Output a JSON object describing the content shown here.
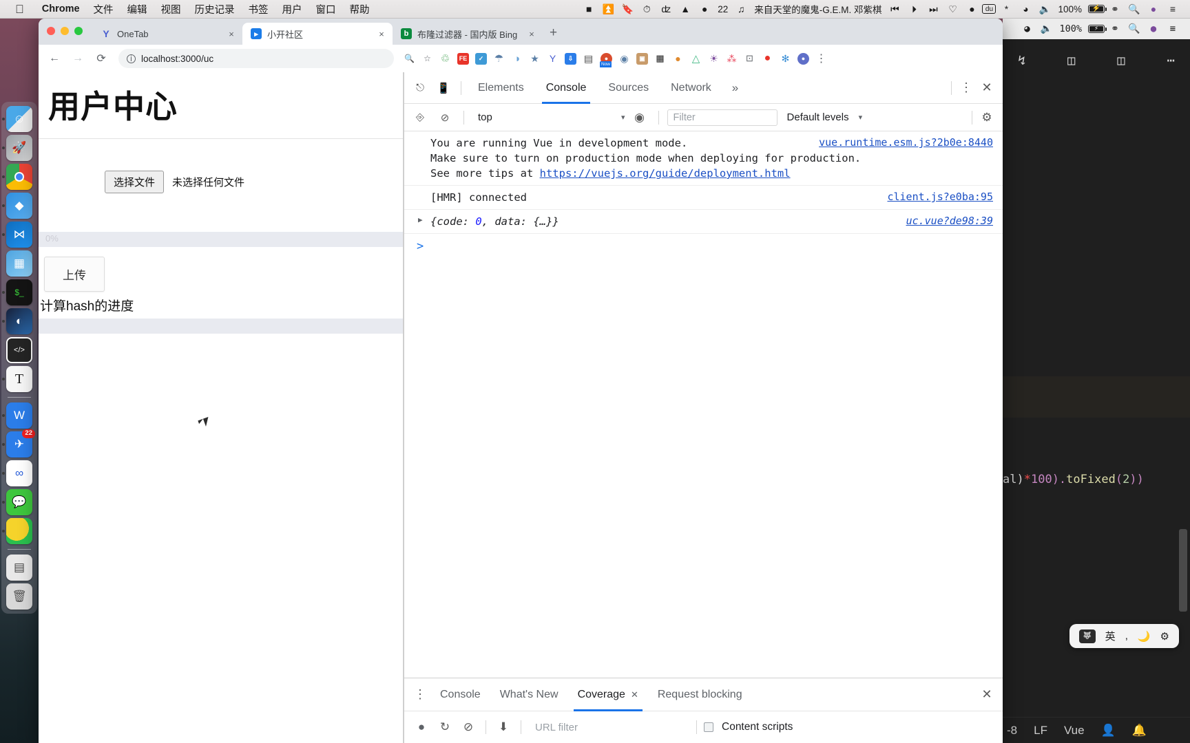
{
  "menubar": {
    "apple": "apple-logo",
    "items": [
      "Chrome",
      "文件",
      "编辑",
      "视图",
      "历史记录",
      "书签",
      "用户",
      "窗口",
      "帮助"
    ],
    "status_icons": [
      "stop-icon",
      "eject-icon",
      "bookmark-icon",
      "clock-icon",
      "flash-icon",
      "triangle-icon"
    ],
    "notify_count": "22",
    "now_playing": "来自天堂的魔鬼-G.E.M. 邓紫棋",
    "media_prev": "prev-track-icon",
    "media_play": "play-icon",
    "media_next": "next-track-icon",
    "heart": "heart-icon",
    "firefox": "flame-icon",
    "baidu": "du",
    "bluetooth": "bluetooth-icon",
    "wifi": "wifi-icon",
    "volume": "volume-icon",
    "battery_pct": "100%",
    "battery_glyph": "⚡",
    "siri": "siri-icon",
    "search": "search-icon",
    "control_center": "control-center-icon"
  },
  "dock": {
    "items": [
      {
        "name": "finder",
        "glyph": "☺",
        "color1": "#4aa8e8",
        "color2": "#eaeaea",
        "running": true
      },
      {
        "name": "launchpad",
        "glyph": "🚀",
        "color1": "#9aa0a6",
        "color2": "#d6d6d6",
        "running": false
      },
      {
        "name": "google-chrome",
        "glyph": "◉",
        "color1": "#34a853",
        "color2": "#ea4335",
        "running": true
      },
      {
        "name": "sketch-editor",
        "glyph": "◆",
        "color1": "#2f8fe0",
        "color2": "#5cb0f0",
        "running": false
      },
      {
        "name": "visual-studio-code",
        "glyph": "⋈",
        "color1": "#0f6cbd",
        "color2": "#2196f3",
        "running": true
      },
      {
        "name": "keynote",
        "glyph": "▦",
        "color1": "#4da3e0",
        "color2": "#8fd0f5",
        "running": false
      },
      {
        "name": "terminal",
        "glyph": "$_",
        "color1": "#1b1b1b",
        "color2": "#2b2b2b",
        "running": true
      },
      {
        "name": "quicktime",
        "glyph": "◐",
        "color1": "#1a1a2e",
        "color2": "#2b6cb0",
        "running": true
      },
      {
        "name": "code-editor",
        "glyph": "</>",
        "color1": "#242424",
        "color2": "#333333",
        "running": false
      },
      {
        "name": "typora",
        "glyph": "T",
        "color1": "#f3f3f3",
        "color2": "#e8e8e8",
        "running": true
      },
      {
        "name": "wps-office",
        "glyph": "W",
        "color1": "#2b7de9",
        "color2": "#3f8ef0",
        "running": true
      },
      {
        "name": "dingtalk",
        "glyph": "✈",
        "color1": "#2b7de9",
        "color2": "#3f8ef0",
        "running": true,
        "badge": "22"
      },
      {
        "name": "baidu-netdisk",
        "glyph": "∞",
        "color1": "#ffffff",
        "color2": "#f2f2f2",
        "running": true
      },
      {
        "name": "wechat",
        "glyph": "💬",
        "color1": "#3ec63e",
        "color2": "#7ada7a",
        "running": true
      },
      {
        "name": "sogou-input",
        "glyph": "S",
        "color1": "#f5d32b",
        "color2": "#2bbf4e",
        "running": true
      },
      {
        "name": "downloads-stack",
        "glyph": "▤",
        "color1": "#e8e8e8",
        "color2": "#cfcfcf",
        "running": false
      },
      {
        "name": "trash",
        "glyph": "🗑",
        "color1": "#dddddd",
        "color2": "#bbbbbb",
        "running": false
      }
    ]
  },
  "browser": {
    "tabs": [
      {
        "title": "OneTab",
        "favicon": "Y",
        "favicon_color": "#5b6bd6",
        "active": false,
        "close": "×"
      },
      {
        "title": "小开社区",
        "favicon": "▷",
        "favicon_color": "#1b7ce8",
        "active": true,
        "close": "×"
      },
      {
        "title": "布隆过滤器 - 国内版 Bing",
        "favicon": "b",
        "favicon_color": "#0b8a3e",
        "active": false,
        "close": "×"
      }
    ],
    "new_tab_label": "+",
    "nav": {
      "back": "←",
      "forward": "→",
      "reload": "⟳"
    },
    "url": "localhost:3000/uc",
    "url_info_glyph": "i",
    "omnibox_actions": [
      "zoom-icon",
      "bookmark-star-icon"
    ],
    "extensions": [
      {
        "name": "recycle-extension",
        "glyph": "♺",
        "color": "#3b9c4a",
        "bg": "transparent"
      },
      {
        "name": "fe-helper-extension",
        "glyph": "FE",
        "color": "#ffffff",
        "bg": "#e8342a"
      },
      {
        "name": "tampermonkey-extension",
        "glyph": "◷",
        "color": "#ffffff",
        "bg": "#3e9ad6"
      },
      {
        "name": "shield-extension",
        "glyph": "⛨",
        "color": "#5b7fa6",
        "bg": "transparent"
      },
      {
        "name": "moon-extension",
        "glyph": "◑",
        "color": "#6aa3d6",
        "bg": "transparent"
      },
      {
        "name": "adblock-extension",
        "glyph": "⛉",
        "color": "#5b7fa6",
        "bg": "transparent"
      },
      {
        "name": "onetab-extension",
        "glyph": "Y",
        "color": "#4a5fd0",
        "bg": "transparent"
      },
      {
        "name": "download-extension",
        "glyph": "⇟",
        "color": "#ffffff",
        "bg": "#2b7de9"
      },
      {
        "name": "reader-extension",
        "glyph": "▤",
        "color": "#4a4a4a",
        "bg": "transparent"
      },
      {
        "name": "now-extension",
        "glyph": "◉",
        "color": "#ffffff",
        "bg": "#d94c2e",
        "tag": "Now"
      },
      {
        "name": "mouse-gesture-extension",
        "glyph": "◍",
        "color": "#5b7fa6",
        "bg": "transparent"
      },
      {
        "name": "clipboard-extension",
        "glyph": "▣",
        "color": "#ffffff",
        "bg": "#c89b6a"
      },
      {
        "name": "qrcode-extension",
        "glyph": "▨",
        "color": "#1b1b1b",
        "bg": "transparent"
      },
      {
        "name": "fox-extension",
        "glyph": "🦊",
        "color": "#e08a2e",
        "bg": "transparent"
      },
      {
        "name": "vue-devtools-extension",
        "glyph": "△",
        "color": "#41b883",
        "bg": "transparent"
      },
      {
        "name": "color-picker-extension",
        "glyph": "◕",
        "color": "#7b4b9c",
        "bg": "transparent"
      },
      {
        "name": "sitemap-extension",
        "glyph": "⁂",
        "color": "#e84a5f",
        "bg": "transparent"
      },
      {
        "name": "screenshot-extension",
        "glyph": "⊡",
        "color": "#5f6368",
        "bg": "transparent"
      },
      {
        "name": "location-extension",
        "glyph": "◉",
        "color": "#ffffff",
        "bg": "#e8342a"
      },
      {
        "name": "puzzle-extension",
        "glyph": "✳",
        "color": "#3b8fd6",
        "bg": "transparent"
      },
      {
        "name": "profile-avatar",
        "glyph": "◉",
        "color": "#ffffff",
        "bg": "#5f6fc8"
      },
      {
        "name": "chrome-menu",
        "glyph": "⋮",
        "color": "#5f6368",
        "bg": "transparent"
      }
    ]
  },
  "page": {
    "title": "用户中心",
    "file_button": "选择文件",
    "file_status": "未选择任何文件",
    "hash_progress_pct": "0%",
    "upload_button": "上传",
    "hash_label": "计算hash的进度",
    "upload_progress_pct": ""
  },
  "devtools": {
    "toolbar": {
      "inspect_icon": "inspect-element-icon",
      "device_icon": "device-toolbar-icon",
      "tabs": [
        {
          "label": "Elements",
          "active": false
        },
        {
          "label": "Console",
          "active": true
        },
        {
          "label": "Sources",
          "active": false
        },
        {
          "label": "Network",
          "active": false
        }
      ],
      "more_tabs": "»",
      "settings_menu": "⋮",
      "close": "✕"
    },
    "filterbar": {
      "sidebar_toggle": "console-sidebar-icon",
      "clear": "clear-console-icon",
      "context": "top",
      "context_caret": "▾",
      "eye_icon": "live-expression-icon",
      "filter_placeholder": "Filter",
      "levels": "Default levels",
      "levels_caret": "▾",
      "settings_gear": "settings-gear-icon"
    },
    "messages": [
      {
        "type": "warning",
        "lines": [
          "You are running Vue in development mode.",
          "Make sure to turn on production mode when deploying for production.",
          "See more tips at "
        ],
        "link": "https://vuejs.org/guide/deployment.html",
        "source": "vue.runtime.esm.js?2b0e:8440"
      },
      {
        "type": "log",
        "text": "[HMR] connected",
        "source": "client.js?e0ba:95"
      },
      {
        "type": "object",
        "expander": "▶",
        "prefix": "{code: ",
        "value": "0",
        "suffix": ", data: {…}}",
        "source": "uc.vue?de98:39"
      }
    ],
    "prompt": ">",
    "drawer": {
      "menu": "⋮",
      "tabs": [
        {
          "label": "Console",
          "active": false,
          "closeable": false
        },
        {
          "label": "What's New",
          "active": false,
          "closeable": false
        },
        {
          "label": "Coverage",
          "active": true,
          "closeable": true,
          "close": "✕"
        },
        {
          "label": "Request blocking",
          "active": false,
          "closeable": false
        }
      ],
      "close": "✕",
      "record": "record-icon",
      "reload": "reload-icon",
      "clear": "clear-icon",
      "export": "export-icon",
      "url_filter_placeholder": "URL filter",
      "content_scripts_label": "Content scripts",
      "content_scripts_checked": false
    }
  },
  "vscode": {
    "status_right": {
      "wifi": "wifi-icon",
      "volume": "volume-icon",
      "battery_pct": "100%",
      "siri": "siri-icon",
      "search": "search-icon",
      "control_center": "control-center-icon"
    },
    "titlebar_icons": [
      "source-control-icon",
      "binary-file-icon",
      "split-editor-icon",
      "more-actions-icon"
    ],
    "code_fragment": {
      "p1": "al)",
      "p2": "*",
      "p3": "100",
      "p4": ").",
      "p5": "toFixed",
      "p6": "(",
      "p7": "2",
      "p8": "))"
    },
    "ime": {
      "logo": "baidu-ime-icon",
      "lang": "英",
      "punct": ",",
      "moon": "moon-icon",
      "settings": "gear-icon"
    },
    "statusbar": [
      "-8",
      "LF",
      "Vue"
    ],
    "statusbar_icons": [
      "feedback-icon",
      "notification-bell-icon"
    ]
  }
}
